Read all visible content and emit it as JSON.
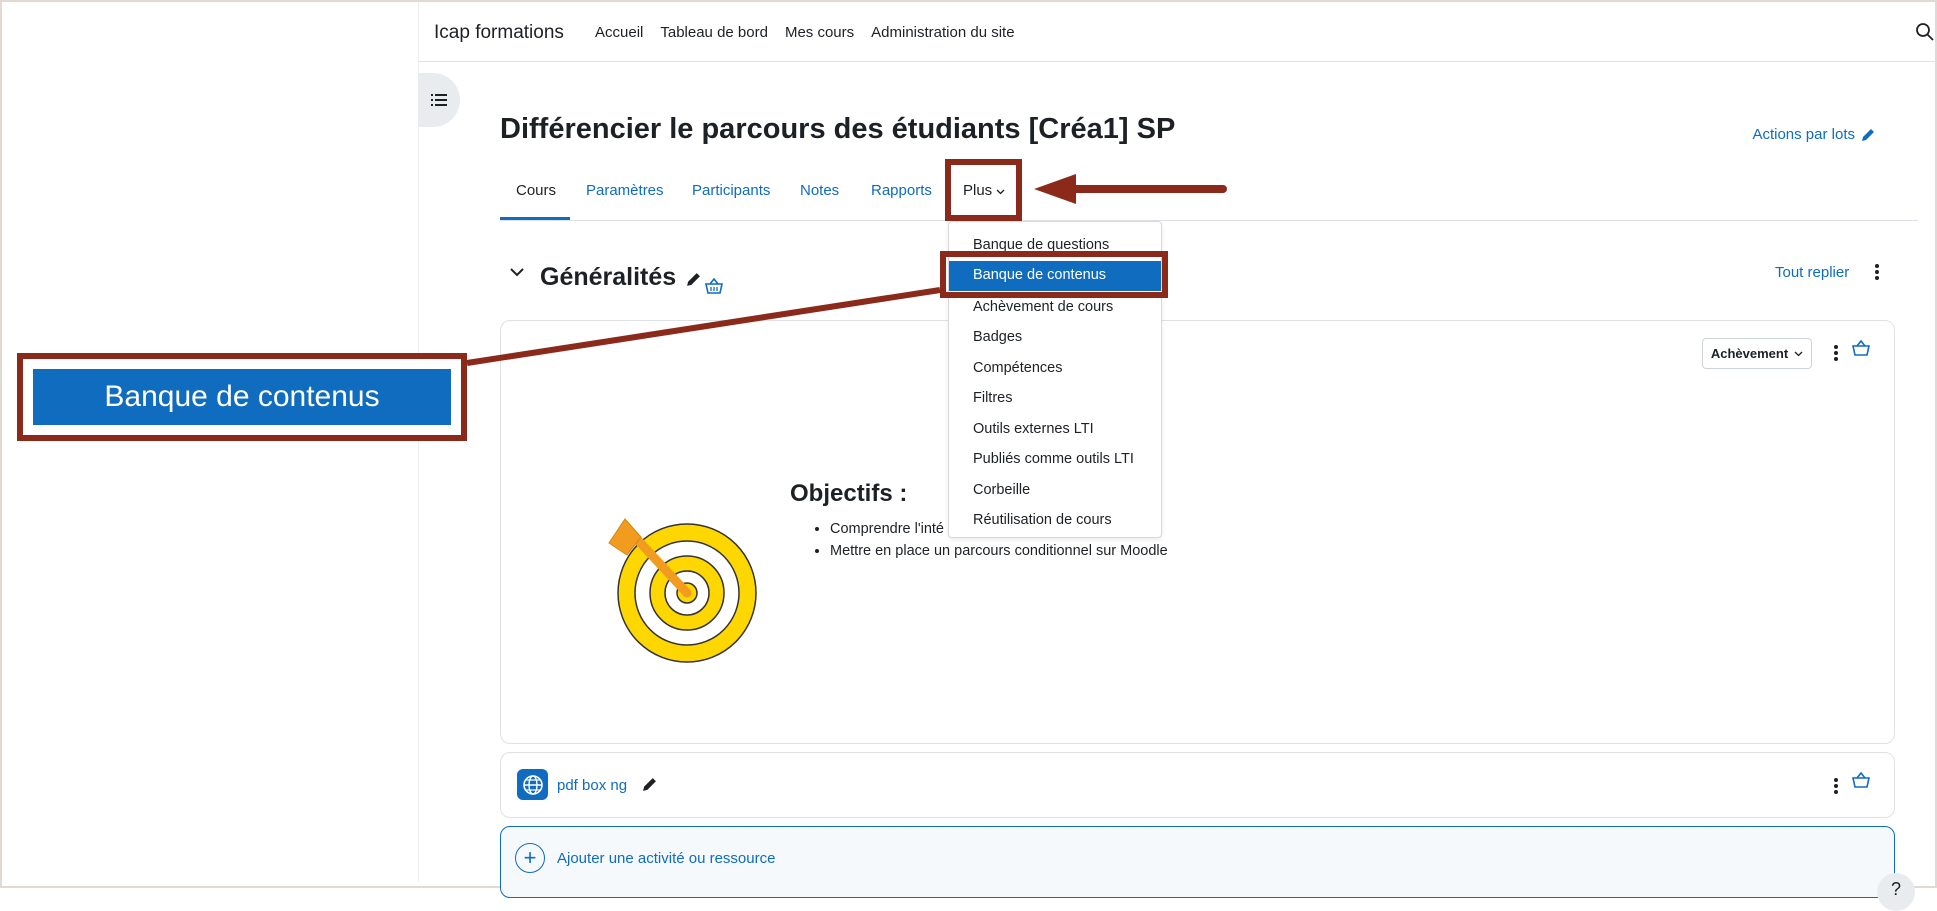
{
  "navbar": {
    "brand": "Icap formations",
    "links": [
      "Accueil",
      "Tableau de bord",
      "Mes cours",
      "Administration du site"
    ]
  },
  "page": {
    "title": "Différencier le parcours des étudiants [Créa1] SP",
    "bulk_actions": "Actions par lots"
  },
  "tabs": [
    "Cours",
    "Paramètres",
    "Participants",
    "Notes",
    "Rapports",
    "Plus"
  ],
  "more_menu": {
    "items": [
      "Banque de questions",
      "Banque de contenus",
      "Achèvement de cours",
      "Badges",
      "Compétences",
      "Filtres",
      "Outils externes LTI",
      "Publiés comme outils LTI",
      "Corbeille",
      "Réutilisation de cours"
    ],
    "selected": "Banque de contenus"
  },
  "section": {
    "title": "Généralités",
    "collapse_all": "Tout replier",
    "completion_button": "Achèvement"
  },
  "summary": {
    "heading": "Objectifs :",
    "bullets": [
      "Comprendre l'inté",
      "Mettre en place un parcours conditionnel sur Moodle"
    ]
  },
  "activity": {
    "name": "pdf box ng"
  },
  "add_activity": "Ajouter une activité ou ressource",
  "help": "?",
  "callout": {
    "label": "Banque de contenus"
  },
  "colors": {
    "primary": "#0f6cbf",
    "annotation": "#8b2a1a",
    "target_yellow": "#ffd700"
  }
}
